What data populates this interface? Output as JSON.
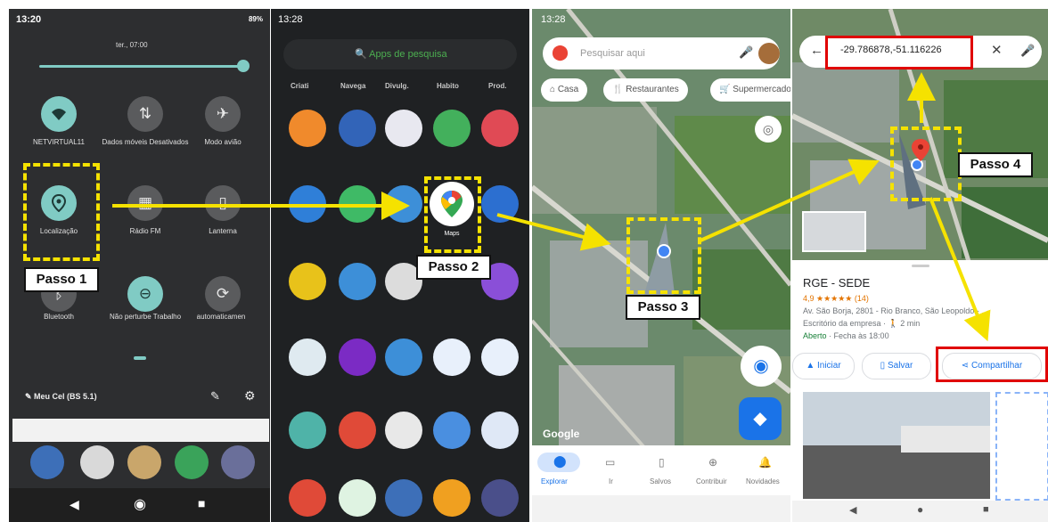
{
  "panel1": {
    "time": "13:20",
    "battery": "89%",
    "alarm": "ter., 07:00",
    "tiles": [
      {
        "label": "NETVIRTUAL11",
        "icon": "wifi-icon"
      },
      {
        "label": "Dados móveis Desativados",
        "icon": "mobile-data-icon"
      },
      {
        "label": "Modo avião",
        "icon": "airplane-icon"
      },
      {
        "label": "Localização",
        "icon": "location-icon"
      },
      {
        "label": "Rádio FM",
        "icon": "radio-icon"
      },
      {
        "label": "Lanterna",
        "icon": "flashlight-icon"
      },
      {
        "label": "Bluetooth",
        "icon": "bluetooth-icon"
      },
      {
        "label": "Não perturbe Trabalho",
        "icon": "do-not-disturb-icon"
      },
      {
        "label": "automaticamen",
        "icon": "rotate-icon"
      }
    ],
    "network": "Meu Cel (BS 5.1)"
  },
  "panel2": {
    "time": "13:28",
    "search_placeholder": "Apps de pesquisa",
    "categories": [
      "Criati",
      "Navega",
      "Divulg.",
      "Habito",
      "Prod."
    ],
    "maps_label": "Maps"
  },
  "panel3": {
    "time": "13:28",
    "search_placeholder": "Pesquisar aqui",
    "chips": [
      "Casa",
      "Restaurantes",
      "Supermercados"
    ],
    "bottom_nav": [
      "Explorar",
      "Ir",
      "Salvos",
      "Contribuir",
      "Novidades"
    ]
  },
  "panel4": {
    "coords": "-29.786878,-51.116226",
    "place_name": "RGE - SEDE",
    "rating": "4,9 ★★★★★ (14)",
    "address": "Av. São Borja, 2801 - Rio Branco, São Leopoldo - ...",
    "category": "Escritório da empresa · 🚶 2 min",
    "status_open": "Aberto",
    "status_rest": " · Fecha às 18:00",
    "btn_start": "Iniciar",
    "btn_save": "Salvar",
    "btn_share": "Compartilhar"
  },
  "callouts": {
    "step1": "Passo 1",
    "step2": "Passo 2",
    "step3": "Passo 3",
    "step4": "Passo 4"
  },
  "colors": {
    "highlight": "#f5e200",
    "emphasis": "#e00000",
    "maps_blue": "#1a73e8",
    "teal_active": "#80cbc4"
  }
}
